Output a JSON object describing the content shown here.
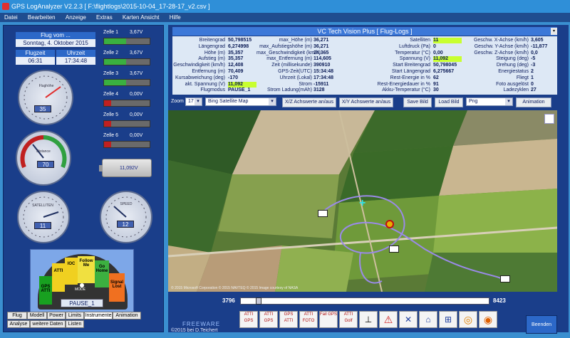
{
  "window": {
    "title": "GPS LogAnalyzer V2.2.3   [ F:\\flightlogs\\2015-10-04_17-28-17_v2.csv ]"
  },
  "menu": [
    "Datei",
    "Bearbeiten",
    "Anzeige",
    "Extras",
    "Karten Ansicht",
    "Hilfe"
  ],
  "flight": {
    "header": "Flug vom ...",
    "date": "Sonntag, 4. Oktober 2015",
    "flugzeit_label": "Flugzeit",
    "uhrzeit_label": "Uhrzeit",
    "flugzeit": "06:31",
    "uhrzeit": "17:34:48"
  },
  "cells": [
    {
      "label": "Zelle 1",
      "voltage": "3,67V",
      "level": 0.48
    },
    {
      "label": "Zelle 2",
      "voltage": "3,67V",
      "level": 0.48
    },
    {
      "label": "Zelle 3",
      "voltage": "3,67V",
      "level": 0.48
    },
    {
      "label": "Zelle 4",
      "voltage": "0,00V",
      "level": 0.15
    },
    {
      "label": "Zelle 5",
      "voltage": "0,00V",
      "level": 0.15
    },
    {
      "label": "Zelle 6",
      "voltage": "0,00V",
      "level": 0.15
    }
  ],
  "pack_voltage": "11,092V",
  "gauges": {
    "height": {
      "label": "Flughöhe",
      "value": "35"
    },
    "distance": {
      "label": "Distance",
      "value": "70"
    },
    "satellites": {
      "label": "SATELLITEN",
      "value": "11"
    },
    "speed": {
      "label": "SPEED",
      "value": "12"
    }
  },
  "mode_gauge": {
    "segments": [
      "GPS ATTI",
      "ATTI",
      "IOC",
      "Follow Me",
      "Go Home",
      "Signal Lost"
    ],
    "label": "MODE",
    "status": "PAUSE_1"
  },
  "left_tabs": {
    "row1": [
      "Flug",
      "Modell",
      "Power",
      "Limits",
      "Instrumente",
      "Animation"
    ],
    "row2": [
      "Analyse",
      "weitere Daten",
      "Listen"
    ]
  },
  "vc_header": "VC Tech Vision Plus [ Flug-Logs ]",
  "info": {
    "col1": [
      [
        "Breitengrad",
        "50,798515"
      ],
      [
        "Längengrad",
        "6,274998"
      ],
      [
        "Höhe (m)",
        "35,357"
      ],
      [
        "Aufstieg (m)",
        "35,357"
      ],
      [
        "Geschwindigkeit (km/h)",
        "12,408"
      ],
      [
        "Entfernung (m)",
        "70,409"
      ],
      [
        "Kursabweichung (deg)",
        "-170"
      ],
      [
        "akt. Spannung (V)",
        "11,092"
      ],
      [
        "Flugmodus",
        "PAUSE_1"
      ]
    ],
    "col2": [
      [
        "max_Höhe (m)",
        "36,271"
      ],
      [
        "max_Aufstiegshöhe (m)",
        "36,271"
      ],
      [
        "max_Geschwindigkeit (km/h)",
        "24,365"
      ],
      [
        "max_Entfernung (m)",
        "114,605"
      ],
      [
        "Zeit (millisekunde)",
        "390910"
      ],
      [
        "GPS-Zeit(UTC)",
        "15:34:48"
      ],
      [
        "Uhrzeit (Lokal)",
        "17:34:48"
      ],
      [
        "Strom",
        "-15911"
      ],
      [
        "Strom Ladung(mAh)",
        "3128"
      ]
    ],
    "col3": [
      [
        "Satelliten",
        "11"
      ],
      [
        "Luftdruck (Pa)",
        "0"
      ],
      [
        "Temperatur (°C)",
        "0,00"
      ],
      [
        "Spannung (V)",
        "11,092"
      ],
      [
        "Start Breitengrad",
        "50,798045"
      ],
      [
        "Start Längengrad",
        "6,275667"
      ],
      [
        "Rest-Energie in %",
        "62"
      ],
      [
        "Rest-Energiedauer in %",
        "91"
      ],
      [
        "Akku-Temperatur (°C)",
        "30"
      ]
    ],
    "col4": [
      [
        "Geschw. X-Achse (km/h)",
        "3,605"
      ],
      [
        "Geschw. Y-Achse (km/h)",
        "-11,877"
      ],
      [
        "Geschw. Z-Achse (km/h)",
        "0,0"
      ],
      [
        "Steigung (deg)",
        "-5"
      ],
      [
        "Drehung (deg)",
        "-3"
      ],
      [
        "Energiestatus",
        "2"
      ],
      [
        "Fliegt",
        "1"
      ],
      [
        "Foto ausgelöst",
        "0"
      ],
      [
        "Ladezyklen",
        "27"
      ]
    ]
  },
  "toolbar": {
    "zoom_label": "Zoom",
    "zoom_value": "17",
    "map_type": "Bing Satellite Map",
    "xz_button": "X/Z Achswerte an/aus",
    "xy_button": "X/Y Achswerte an/aus",
    "save_button": "Save Bild",
    "load_button": "Load Bild",
    "format": "Png",
    "animation_button": "Animation"
  },
  "map_attribution": "© 2015 Microsoft Corporation  © 2015 NAVTEQ  © 2015 Image courtesy of NASA",
  "slider": {
    "start": "3796",
    "end": "8423",
    "position": 0.06
  },
  "footer": {
    "freeware": "FREEWARE",
    "copyright": "©2015  bei D.Teichert"
  },
  "bottom_buttons": [
    "ATTI GPS",
    "ATTI GPS",
    "GPS ATTI",
    "ATTI FOTO",
    "Fail GPS",
    "ATTI Golf"
  ],
  "beenden": "Beenden"
}
